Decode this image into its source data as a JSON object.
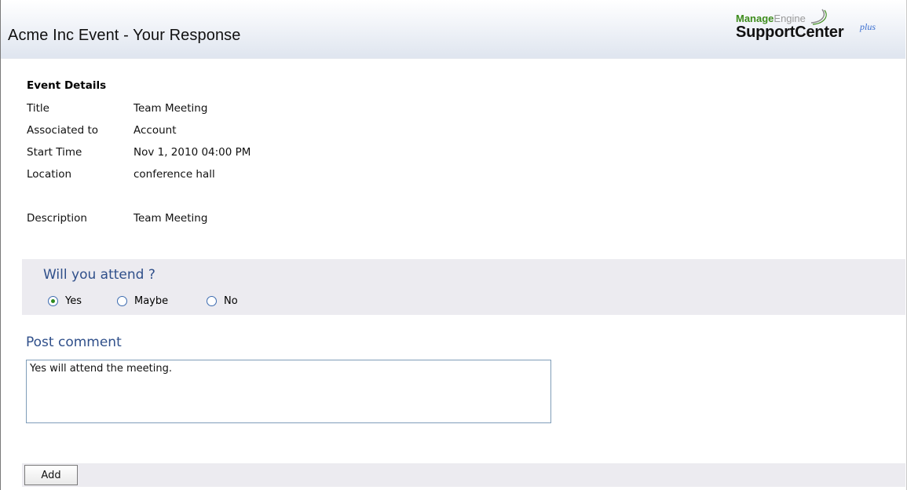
{
  "header": {
    "title": "Acme Inc  Event - Your Response",
    "logo": {
      "line1_brand": "Manage",
      "line1_engine": "Engine",
      "line2": "SupportCenter",
      "plus": "plus"
    }
  },
  "event": {
    "heading": "Event Details",
    "fields": [
      {
        "label": "Title",
        "value": "Team Meeting"
      },
      {
        "label": "Associated to",
        "value": "Account"
      },
      {
        "label": "Start Time",
        "value": "Nov 1, 2010 04:00 PM"
      },
      {
        "label": "Location",
        "value": "conference hall"
      },
      {
        "label": "Description",
        "value": "Team Meeting"
      }
    ]
  },
  "attend": {
    "question": "Will you attend ?",
    "options": [
      {
        "label": "Yes",
        "checked": true
      },
      {
        "label": "Maybe",
        "checked": false
      },
      {
        "label": "No",
        "checked": false
      }
    ]
  },
  "comment": {
    "heading": "Post comment",
    "value": "Yes will attend the meeting."
  },
  "actions": {
    "add_label": "Add"
  },
  "colors": {
    "accent": "#2f4f8a",
    "panel": "#ecebf0",
    "radio_dot": "#2d8a1e"
  }
}
